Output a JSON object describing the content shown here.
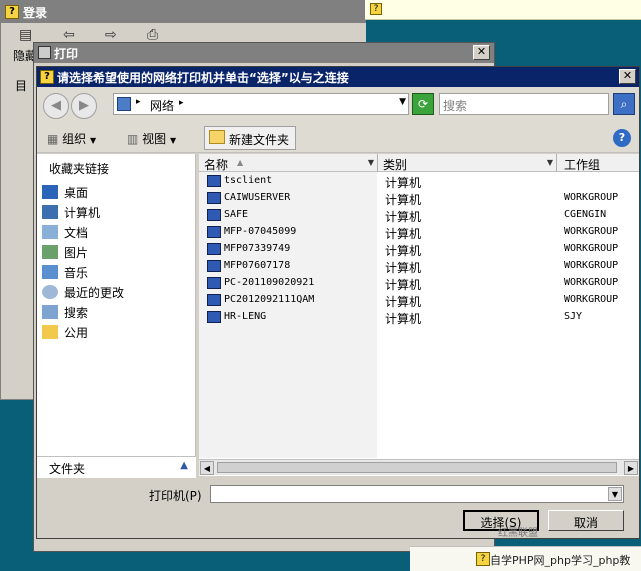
{
  "login_window": {
    "title": "登录",
    "hide_label": "隐藏",
    "left_label": "目"
  },
  "print_window": {
    "title": "打印"
  },
  "dialog": {
    "title": "请选择希望使用的网络打印机并单击“选择”以与之连接",
    "close_glyph": "✕",
    "address": {
      "sep": "▸",
      "text": "网络",
      "sep2": "▸"
    },
    "search": {
      "placeholder": "搜索"
    },
    "toolbar": {
      "organize": "组织",
      "views": "视图",
      "new_folder": "新建文件夹"
    },
    "nav": {
      "favorites_header": "收藏夹链接",
      "items": [
        {
          "label": "桌面"
        },
        {
          "label": "计算机"
        },
        {
          "label": "文档"
        },
        {
          "label": "图片"
        },
        {
          "label": "音乐"
        },
        {
          "label": "最近的更改"
        },
        {
          "label": "搜索"
        },
        {
          "label": "公用"
        }
      ],
      "folders": "文件夹"
    },
    "columns": {
      "name": "名称",
      "type": "类别",
      "workgroup": "工作组"
    },
    "rows": [
      {
        "name": "tsclient",
        "type": "计算机",
        "group": ""
      },
      {
        "name": "CAIWUSERVER",
        "type": "计算机",
        "group": "WORKGROUP"
      },
      {
        "name": "SAFE",
        "type": "计算机",
        "group": "CGENGIN"
      },
      {
        "name": "MFP-07045099",
        "type": "计算机",
        "group": "WORKGROUP"
      },
      {
        "name": "MFP07339749",
        "type": "计算机",
        "group": "WORKGROUP"
      },
      {
        "name": "MFP07607178",
        "type": "计算机",
        "group": "WORKGROUP"
      },
      {
        "name": "PC-201109020921",
        "type": "计算机",
        "group": "WORKGROUP"
      },
      {
        "name": "PC2012092111QAM",
        "type": "计算机",
        "group": "WORKGROUP"
      },
      {
        "name": "HR-LENG",
        "type": "计算机",
        "group": "SJY"
      }
    ],
    "printer_label": "打印机(P)",
    "printer_value": "",
    "select_button": "选择(S)",
    "cancel_button": "取消"
  },
  "banner_bottom": "自学PHP网_php学习_php教",
  "watermark": "红黑联盟"
}
